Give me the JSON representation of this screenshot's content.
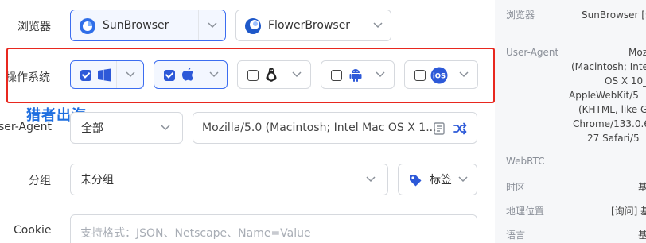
{
  "browser_row": {
    "label": "浏览器",
    "options": [
      {
        "name": "SunBrowser",
        "selected": true
      },
      {
        "name": "FlowerBrowser",
        "selected": false
      }
    ]
  },
  "os_row": {
    "label": "操作系统",
    "options": [
      {
        "name": "windows-icon",
        "checked": true
      },
      {
        "name": "apple-icon",
        "checked": true
      },
      {
        "name": "linux-icon",
        "checked": false
      },
      {
        "name": "android-icon",
        "checked": false
      },
      {
        "name": "ios-icon",
        "checked": false,
        "text": "iOS"
      }
    ]
  },
  "watermark": "猎者出海",
  "ua_row": {
    "label": "ser-Agent",
    "scope": "全部",
    "value": "Mozilla/5.0 (Macintosh; Intel Mac OS X 1..."
  },
  "group_row": {
    "label": "分组",
    "value": "未分组",
    "tag_label": "标签"
  },
  "cookie_row": {
    "label": "Cookie",
    "placeholder": "支持格式：JSON、Netscape、Name=Value"
  },
  "sidebar": {
    "browser": {
      "key": "浏览器",
      "value": "SunBrowser [着"
    },
    "ua": {
      "key": "User-Agent",
      "lines": [
        "Mozill",
        "(Macintosh; Inte",
        "OS X 10_",
        "AppleWebKit/5",
        "(KHTML, like G",
        "Chrome/133.0.6",
        "27 Safari/5"
      ]
    },
    "webrtc": {
      "key": "WebRTC"
    },
    "timezone": {
      "key": "时区",
      "value": "基"
    },
    "geo": {
      "key": "地理位置",
      "value": "[询问] 基"
    },
    "language": {
      "key": "语言",
      "value": "基"
    }
  },
  "colors": {
    "accent": "#3c6df0",
    "highlight_frame": "#e8281f",
    "watermark": "#1f6fe0"
  }
}
